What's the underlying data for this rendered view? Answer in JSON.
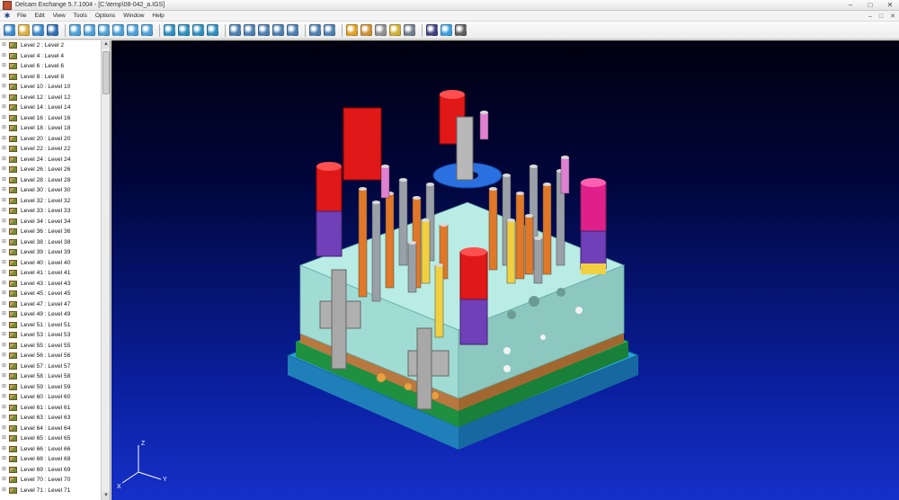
{
  "window": {
    "title": "Delcam Exchange 5.7.1004 - [C:\\temp\\08-042_a.IGS]",
    "controls": [
      "–",
      "□",
      "✕"
    ]
  },
  "menubar": {
    "items": [
      "File",
      "Edit",
      "View",
      "Tools",
      "Options",
      "Window",
      "Help"
    ],
    "mdi_controls": [
      "–",
      "□",
      "✕"
    ]
  },
  "toolbar": {
    "buttons": [
      {
        "icon": "open-icon",
        "color": "#3a8ad0"
      },
      {
        "icon": "open-folder-icon",
        "color": "#d9b040"
      },
      {
        "icon": "import-icon",
        "color": "#3a8ad0"
      },
      {
        "icon": "save-icon",
        "color": "#2f6fb5"
      },
      {
        "icon": "sep"
      },
      {
        "icon": "view-front-icon",
        "color": "#4aa0d8"
      },
      {
        "icon": "view-back-icon",
        "color": "#4aa0d8"
      },
      {
        "icon": "view-left-icon",
        "color": "#4aa0d8"
      },
      {
        "icon": "view-right-icon",
        "color": "#4aa0d8"
      },
      {
        "icon": "view-top-icon",
        "color": "#4aa0d8"
      },
      {
        "icon": "view-bottom-icon",
        "color": "#4aa0d8"
      },
      {
        "icon": "sep"
      },
      {
        "icon": "iso-view-1-icon",
        "color": "#2a90c0"
      },
      {
        "icon": "iso-view-2-icon",
        "color": "#2a90c0"
      },
      {
        "icon": "iso-view-3-icon",
        "color": "#2a90c0"
      },
      {
        "icon": "iso-view-4-icon",
        "color": "#2a90c0"
      },
      {
        "icon": "sep"
      },
      {
        "icon": "zoom-in-icon",
        "color": "#4a7fb0"
      },
      {
        "icon": "zoom-out-icon",
        "color": "#4a7fb0"
      },
      {
        "icon": "zoom-window-icon",
        "color": "#4a7fb0"
      },
      {
        "icon": "zoom-fit-icon",
        "color": "#4a7fb0"
      },
      {
        "icon": "zoom-previous-icon",
        "color": "#4a7fb0"
      },
      {
        "icon": "sep"
      },
      {
        "icon": "zoom-extents-icon",
        "color": "#4a7fb0"
      },
      {
        "icon": "pan-icon",
        "color": "#4a7fb0"
      },
      {
        "icon": "sep"
      },
      {
        "icon": "shade-icon",
        "color": "#e0a020"
      },
      {
        "icon": "wireframe-icon",
        "color": "#d09030"
      },
      {
        "icon": "shade-edges-icon",
        "color": "#909090"
      },
      {
        "icon": "light-icon",
        "color": "#d0b030"
      },
      {
        "icon": "select-icon",
        "color": "#708090"
      },
      {
        "icon": "sep"
      },
      {
        "icon": "layers-icon",
        "color": "#404080"
      },
      {
        "icon": "globe-icon",
        "color": "#3aa0e0"
      },
      {
        "icon": "dropdown-icon",
        "color": "#606060"
      }
    ]
  },
  "tree": {
    "items": [
      "Level 2 : Level 2",
      "Level 4 : Level 4",
      "Level 6 : Level 6",
      "Level 8 : Level 8",
      "Level 10 : Level 10",
      "Level 12 : Level 12",
      "Level 14 : Level 14",
      "Level 16 : Level 16",
      "Level 18 : Level 18",
      "Level 20 : Level 20",
      "Level 22 : Level 22",
      "Level 24 : Level 24",
      "Level 26 : Level 26",
      "Level 28 : Level 28",
      "Level 30 : Level 30",
      "Level 32 : Level 32",
      "Level 33 : Level 33",
      "Level 34 : Level 34",
      "Level 36 : Level 36",
      "Level 38 : Level 38",
      "Level 39 : Level 39",
      "Level 40 : Level 40",
      "Level 41 : Level 41",
      "Level 43 : Level 43",
      "Level 45 : Level 45",
      "Level 47 : Level 47",
      "Level 49 : Level 49",
      "Level 51 : Level 51",
      "Level 53 : Level 53",
      "Level 55 : Level 55",
      "Level 56 : Level 56",
      "Level 57 : Level 57",
      "Level 58 : Level 58",
      "Level 59 : Level 59",
      "Level 60 : Level 60",
      "Level 61 : Level 61",
      "Level 63 : Level 63",
      "Level 64 : Level 64",
      "Level 65 : Level 65",
      "Level 66 : Level 66",
      "Level 68 : Level 68",
      "Level 69 : Level 69",
      "Level 70 : Level 70",
      "Level 71 : Level 71"
    ]
  },
  "viewport": {
    "axes": {
      "x": "X",
      "y": "Y",
      "z": "Z"
    },
    "colors": {
      "background_top": "#000010",
      "background_bottom": "#1530c8",
      "plate": "#a8e0d8",
      "red": "#e01818",
      "orange": "#e07828",
      "pink": "#e060b0",
      "purple": "#8040c0"
    }
  }
}
